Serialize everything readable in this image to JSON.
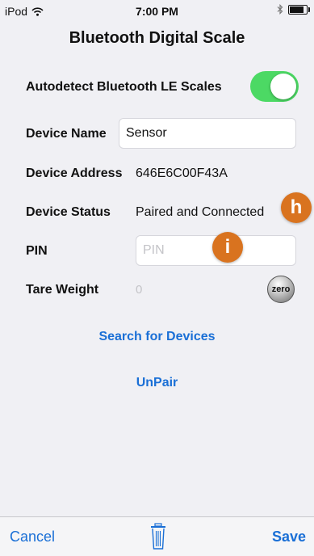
{
  "status_bar": {
    "device": "iPod",
    "time": "7:00 PM",
    "battery_level": 0.75
  },
  "header": {
    "title": "Bluetooth Digital Scale"
  },
  "autodetect": {
    "label": "Autodetect Bluetooth LE Scales",
    "enabled": true
  },
  "device_name": {
    "label": "Device Name",
    "value": "Sensor"
  },
  "device_address": {
    "label": "Device Address",
    "value": "646E6C00F43A"
  },
  "device_status": {
    "label": "Device Status",
    "value": "Paired and Connected"
  },
  "pin": {
    "label": "PIN",
    "value": "",
    "placeholder": "PIN"
  },
  "tare": {
    "label": "Tare Weight",
    "value": "0",
    "zero_label": "zero"
  },
  "badges": {
    "h": "h",
    "i": "i"
  },
  "actions": {
    "search": "Search for Devices",
    "unpair": "UnPair"
  },
  "toolbar": {
    "cancel": "Cancel",
    "save": "Save"
  },
  "colors": {
    "accent": "#1a6fd6",
    "toggle_on": "#4cd964",
    "badge": "#d9731f",
    "background": "#f0f0f4"
  },
  "icons": [
    "wifi-icon",
    "bluetooth-icon",
    "battery-icon",
    "trash-icon"
  ]
}
